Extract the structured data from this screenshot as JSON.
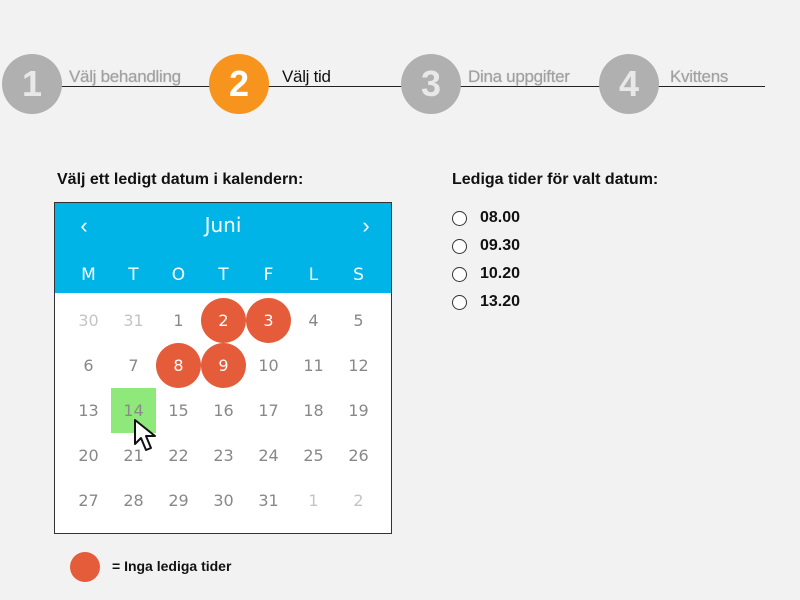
{
  "steps": [
    {
      "number": "1",
      "label": "Välj behandling",
      "active": false
    },
    {
      "number": "2",
      "label": "Välj tid",
      "active": true
    },
    {
      "number": "3",
      "label": "Dina uppgifter",
      "active": false
    },
    {
      "number": "4",
      "label": "Kvittens",
      "active": false
    }
  ],
  "calendar": {
    "heading": "Välj ett ledigt datum i kalendern:",
    "month": "Juni",
    "prev_icon": "chevron-left-icon",
    "next_icon": "chevron-right-icon",
    "prev_label": "‹",
    "next_label": "›",
    "weekdays": [
      "M",
      "T",
      "O",
      "T",
      "F",
      "L",
      "S"
    ],
    "weeks": [
      [
        {
          "d": "30",
          "s": "other"
        },
        {
          "d": "31",
          "s": "other"
        },
        {
          "d": "1",
          "s": ""
        },
        {
          "d": "2",
          "s": "busy"
        },
        {
          "d": "3",
          "s": "busy"
        },
        {
          "d": "4",
          "s": ""
        },
        {
          "d": "5",
          "s": ""
        }
      ],
      [
        {
          "d": "6",
          "s": ""
        },
        {
          "d": "7",
          "s": ""
        },
        {
          "d": "8",
          "s": "busy"
        },
        {
          "d": "9",
          "s": "busy"
        },
        {
          "d": "10",
          "s": ""
        },
        {
          "d": "11",
          "s": ""
        },
        {
          "d": "12",
          "s": ""
        }
      ],
      [
        {
          "d": "13",
          "s": ""
        },
        {
          "d": "14",
          "s": "selected"
        },
        {
          "d": "15",
          "s": ""
        },
        {
          "d": "16",
          "s": ""
        },
        {
          "d": "17",
          "s": ""
        },
        {
          "d": "18",
          "s": ""
        },
        {
          "d": "19",
          "s": ""
        }
      ],
      [
        {
          "d": "20",
          "s": ""
        },
        {
          "d": "21",
          "s": ""
        },
        {
          "d": "22",
          "s": ""
        },
        {
          "d": "23",
          "s": ""
        },
        {
          "d": "24",
          "s": ""
        },
        {
          "d": "25",
          "s": ""
        },
        {
          "d": "26",
          "s": ""
        }
      ],
      [
        {
          "d": "27",
          "s": ""
        },
        {
          "d": "28",
          "s": ""
        },
        {
          "d": "29",
          "s": ""
        },
        {
          "d": "30",
          "s": ""
        },
        {
          "d": "31",
          "s": ""
        },
        {
          "d": "1",
          "s": "other"
        },
        {
          "d": "2",
          "s": "other"
        }
      ]
    ],
    "selected_day": "14",
    "colors": {
      "header": "#00b4e8",
      "busy": "#e45c3a",
      "selected": "#8ee87a",
      "active_step": "#f7941d",
      "inactive_step": "#b0b0b0"
    }
  },
  "times": {
    "heading": "Lediga tider för valt datum:",
    "options": [
      "08.00",
      "09.30",
      "10.20",
      "13.20"
    ]
  },
  "legend": {
    "text": "= Inga lediga tider"
  },
  "cursor_icon": "mouse-pointer-icon"
}
